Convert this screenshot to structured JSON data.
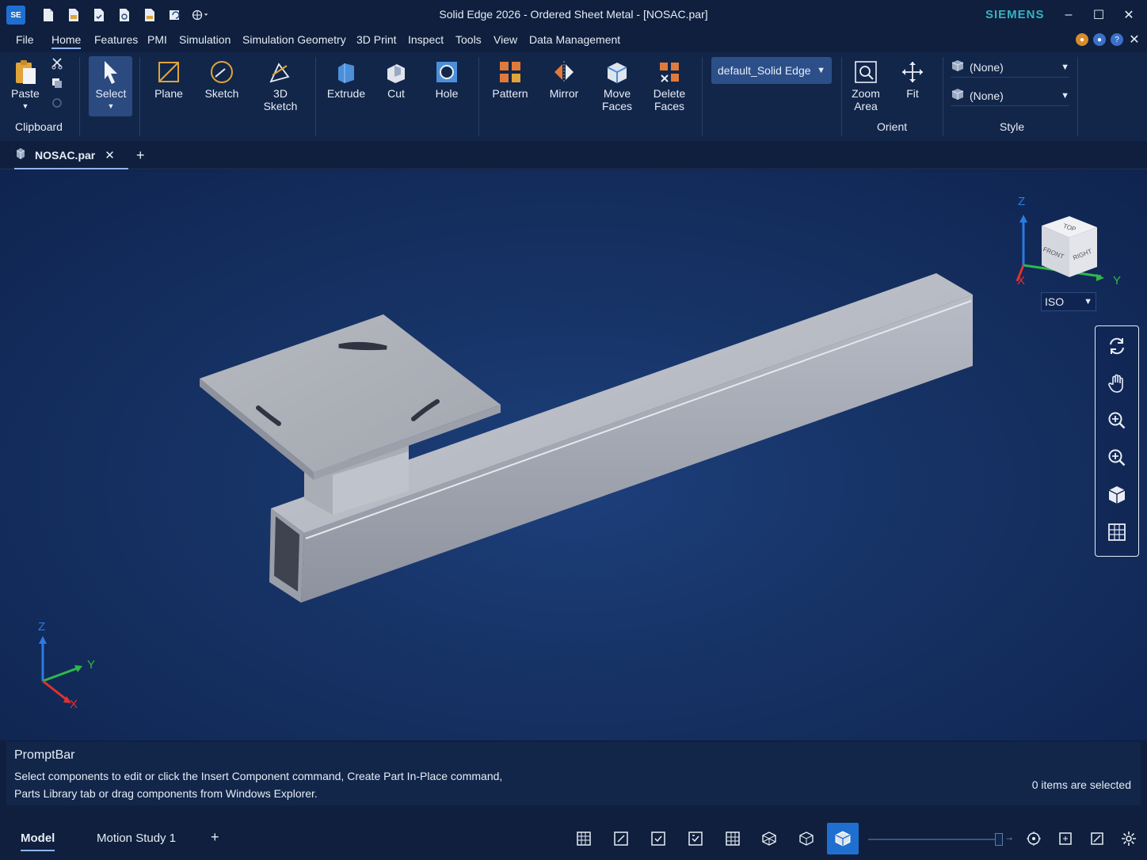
{
  "app": {
    "logo": "SE",
    "title": "Solid Edge 2026 - Ordered Sheet Metal - [NOSAC.par]",
    "brand": "SIEMENS",
    "brand_color": "#38b3c2"
  },
  "quick_access": [
    "new-icon",
    "open-icon",
    "save-icon",
    "save-as-icon",
    "print-icon",
    "undo-icon",
    "customize-icon"
  ],
  "window_controls": {
    "minimize": "–",
    "maximize": "☐",
    "close": "✕"
  },
  "menu_tabs": [
    "File",
    "Home",
    "Features",
    "PMI",
    "Simulation",
    "Simulation Geometry",
    "3D Print",
    "Inspect",
    "Tools",
    "View",
    "Data Management"
  ],
  "active_menu_tab": "Home",
  "ribbon": {
    "clipboard": {
      "paste": "Paste",
      "group_label": "Clipboard"
    },
    "select": "Select",
    "plane": "Plane",
    "sketch": "Sketch",
    "sketch3d": "3D\nSketch",
    "extrude": "Extrude",
    "cut": "Cut",
    "hole": "Hole",
    "pattern": "Pattern",
    "mirror": "Mirror",
    "move_faces": "Move\nFaces",
    "delete_faces": "Delete\nFaces",
    "template_dropdown": "default_Solid Edge",
    "zoom_area": "Zoom\nArea",
    "fit": "Fit",
    "orient_label": "Orient",
    "style_dropdown_1": "(None)",
    "style_dropdown_2": "(None)",
    "style_label": "Style"
  },
  "document_tab": {
    "name": "NOSAC.par",
    "close": "✕",
    "add": "+"
  },
  "viewport": {
    "view_cube_faces": {
      "top": "TOP",
      "front": "FRONT",
      "right": "RIGHT"
    },
    "axis_labels": {
      "x": "X",
      "y": "Y",
      "z": "Z"
    },
    "view_orientation": "ISO",
    "axis_colors": {
      "x": "#e0322f",
      "y": "#2fb84a",
      "z": "#2b7be0"
    },
    "vertical_tools": [
      "rotate-icon",
      "pan-hand-icon",
      "zoom-icon",
      "zoom-area-icon",
      "view-cube-icon",
      "grid-icon"
    ]
  },
  "promptbar": {
    "title": "PromptBar",
    "message_line1": "Select components to edit or click the Insert Component command, Create Part In-Place command,",
    "message_line2": "Parts Library tab or drag components from Windows Explorer.",
    "status": "0 items are selected"
  },
  "status_bar": {
    "tabs": [
      "Model",
      "Motion Study 1"
    ],
    "active_tab": "Model",
    "add": "+",
    "view_icons": [
      "view-grid-1-icon",
      "view-grid-2-icon",
      "view-grid-3-icon",
      "view-grid-4-icon",
      "view-grid-5-icon",
      "wireframe-icon",
      "shaded-icon",
      "shaded-edges-icon"
    ],
    "right_icons": [
      "orbit-icon",
      "fit-icon",
      "settings-view-icon",
      "gear-icon"
    ]
  }
}
